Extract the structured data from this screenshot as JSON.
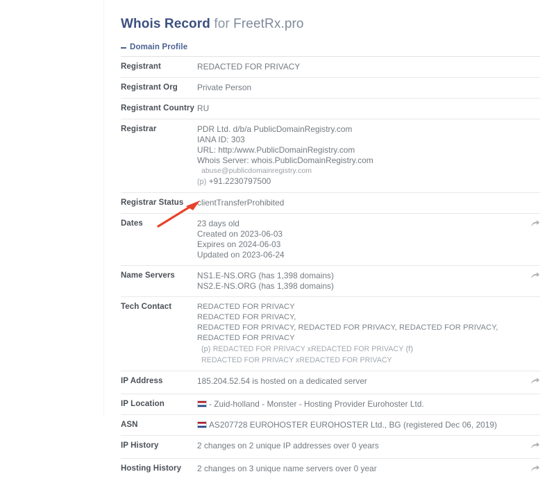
{
  "header": {
    "title_strong": "Whois Record",
    "title_rest": " for ",
    "title_domain": "FreetRx.pro"
  },
  "section": {
    "toggle_icon": "minus-icon",
    "label": "Domain Profile"
  },
  "icons": {
    "share": "share-arrow-icon",
    "flag": "netherlands-flag-icon"
  },
  "rows": [
    {
      "label": "Registrant",
      "lines": [
        "REDACTED FOR PRIVACY"
      ],
      "share": false
    },
    {
      "label": "Registrant Org",
      "lines": [
        "Private Person"
      ],
      "share": false
    },
    {
      "label": "Registrant Country",
      "lines": [
        "RU"
      ],
      "share": false
    },
    {
      "label": "Registrar",
      "lines": [
        "PDR Ltd. d/b/a PublicDomainRegistry.com",
        "IANA ID: 303",
        "URL: http:/www.PublicDomainRegistry.com",
        "Whois Server: whois.PublicDomainRegistry.com"
      ],
      "small_line": "abuse@publicdomainregistry.com",
      "phone_prefix": "(p)",
      "phone": "+91.2230797500",
      "share": false
    },
    {
      "label": "Registrar Status",
      "lines": [
        "clientTransferProhibited"
      ],
      "share": false
    },
    {
      "label": "Dates",
      "lines": [
        "23 days old",
        "Created on 2023-06-03",
        "Expires on 2024-06-03",
        "Updated on 2023-06-24"
      ],
      "share": true
    },
    {
      "label": "Name Servers",
      "lines": [
        "NS1.E-NS.ORG (has 1,398 domains)",
        "NS2.E-NS.ORG (has 1,398 domains)"
      ],
      "share": true
    }
  ],
  "tech_contact": {
    "label": "Tech Contact",
    "lines": [
      "REDACTED FOR PRIVACY",
      "REDACTED FOR PRIVACY,",
      "REDACTED FOR PRIVACY, REDACTED FOR PRIVACY, REDACTED FOR PRIVACY, REDACTED FOR PRIVACY"
    ],
    "phone_prefix": "(p)",
    "phone_line": "REDACTED FOR PRIVACY xREDACTED FOR PRIVACY",
    "fax_prefix": "(f)",
    "fax_line": "REDACTED FOR PRIVACY xREDACTED FOR PRIVACY"
  },
  "bottom_rows": [
    {
      "label": "IP Address",
      "text": "185.204.52.54 is hosted on a dedicated server",
      "flag": false,
      "share": true
    },
    {
      "label": "IP Location",
      "text": "- Zuid-holland - Monster - Hosting Provider Eurohoster Ltd.",
      "flag": true,
      "share": false
    },
    {
      "label": "ASN",
      "text": "AS207728 EUROHOSTER EUROHOSTER Ltd., BG (registered Dec 06, 2019)",
      "flag": true,
      "share": false
    },
    {
      "label": "IP History",
      "text": "2 changes on 2 unique IP addresses over 0 years",
      "flag": false,
      "share": true
    },
    {
      "label": "Hosting History",
      "text": "2 changes on 3 unique name servers over 0 year",
      "flag": false,
      "share": true
    }
  ],
  "annotation": {
    "name": "red-arrow-annotation",
    "color": "#e8422a",
    "points_to": "23 days old"
  }
}
